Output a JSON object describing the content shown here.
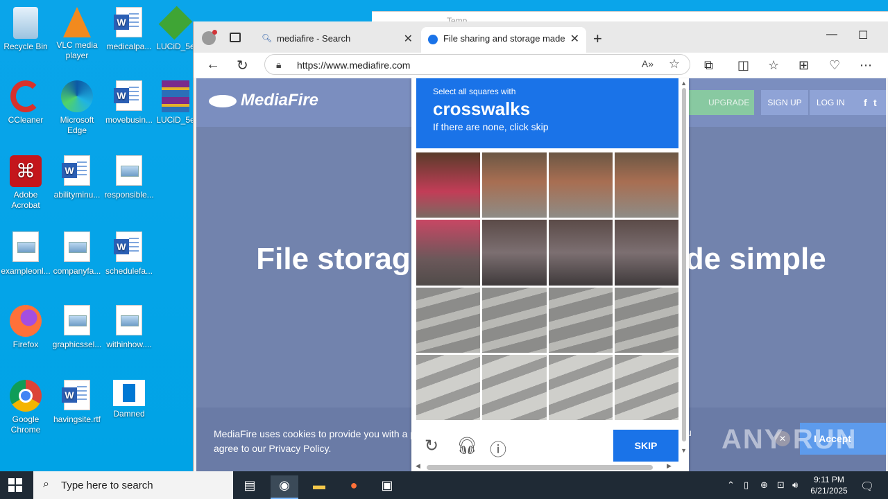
{
  "desktop": {
    "icons": [
      {
        "label": "Recycle Bin",
        "icon": "recycle-bin-icon"
      },
      {
        "label": "VLC media player",
        "icon": "vlc-icon"
      },
      {
        "label": "medicalpa...",
        "icon": "word-document-icon"
      },
      {
        "label": "LUCiD_5e",
        "icon": "gem-icon"
      },
      {
        "label": "CCleaner",
        "icon": "ccleaner-icon"
      },
      {
        "label": "Microsoft Edge",
        "icon": "edge-icon"
      },
      {
        "label": "movebusin...",
        "icon": "word-document-icon"
      },
      {
        "label": "LUCiD_5e",
        "icon": "winrar-icon"
      },
      {
        "label": "Adobe Acrobat",
        "icon": "acrobat-icon"
      },
      {
        "label": "abilityminu...",
        "icon": "word-document-icon"
      },
      {
        "label": "responsible...",
        "icon": "image-file-icon"
      },
      {
        "label": "exampleonl...",
        "icon": "image-file-icon"
      },
      {
        "label": "companyfa...",
        "icon": "image-file-icon"
      },
      {
        "label": "schedulefa...",
        "icon": "word-document-icon"
      },
      {
        "label": "Firefox",
        "icon": "firefox-icon"
      },
      {
        "label": "graphicssel...",
        "icon": "image-file-icon"
      },
      {
        "label": "withinhow....",
        "icon": "image-file-icon"
      },
      {
        "label": "Google Chrome",
        "icon": "chrome-icon"
      },
      {
        "label": "havingsite.rtf",
        "icon": "word-document-icon"
      },
      {
        "label": "Damned",
        "icon": "blank-file-icon"
      }
    ],
    "bg_window_title": "Temp"
  },
  "browser": {
    "tabs": [
      {
        "label": "mediafire - Search",
        "icon": "search-icon"
      },
      {
        "label": "File sharing and storage made sim",
        "icon": "mediafire-icon"
      }
    ],
    "address": "https://www.mediafire.com"
  },
  "page": {
    "logo": "MediaFire",
    "upgrade": "UPGRADE",
    "signup": "SIGN UP",
    "login": "LOG IN",
    "hero_left": "File storag",
    "hero_right": "de simple",
    "cookie_text": "MediaFire uses cookies to provide you with a p",
    "cookie_text2": "agree to our Privacy Policy.",
    "cookie_tail": "u",
    "accept": "I Accept"
  },
  "captcha": {
    "instruction": "Select all squares with",
    "target": "crosswalks",
    "hint": "If there are none, click skip",
    "skip": "SKIP"
  },
  "watermark": "ANY RUN",
  "taskbar": {
    "search_placeholder": "Type here to search",
    "time": "9:11 PM",
    "date": "6/21/2025"
  }
}
